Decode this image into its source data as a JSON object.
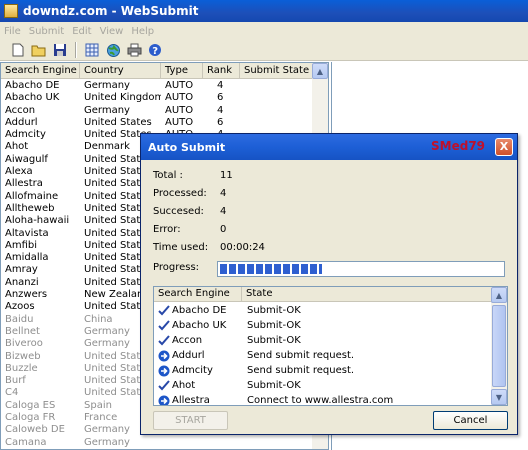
{
  "window": {
    "title": "downdz.com - WebSubmit"
  },
  "menu": [
    "File",
    "Submit",
    "Edit",
    "View",
    "Help"
  ],
  "toolbar": {
    "icons": [
      "new-icon",
      "open-icon",
      "save-icon",
      "grid-icon",
      "globe-icon",
      "print-icon",
      "help-icon"
    ]
  },
  "list": {
    "columns": [
      "Search Engine",
      "Country",
      "Type",
      "Rank",
      "Submit State"
    ],
    "rows": [
      {
        "engine": "Abacho DE",
        "country": "Germany",
        "type": "AUTO",
        "rank": "4",
        "state": "",
        "grey": false
      },
      {
        "engine": "Abacho UK",
        "country": "United Kingdom",
        "type": "AUTO",
        "rank": "6",
        "state": "",
        "grey": false
      },
      {
        "engine": "Accon",
        "country": "Germany",
        "type": "AUTO",
        "rank": "4",
        "state": "",
        "grey": false
      },
      {
        "engine": "Addurl",
        "country": "United States",
        "type": "AUTO",
        "rank": "6",
        "state": "",
        "grey": false
      },
      {
        "engine": "Admcity",
        "country": "United States",
        "type": "AUTO",
        "rank": "4",
        "state": "",
        "grey": false
      },
      {
        "engine": "Ahot",
        "country": "Denmark",
        "type": "",
        "rank": "",
        "state": "",
        "grey": false
      },
      {
        "engine": "Aiwagulf",
        "country": "United States",
        "type": "",
        "rank": "",
        "state": "",
        "grey": false
      },
      {
        "engine": "Alexa",
        "country": "United States",
        "type": "",
        "rank": "",
        "state": "",
        "grey": false
      },
      {
        "engine": "Allestra",
        "country": "United States",
        "type": "",
        "rank": "",
        "state": "",
        "grey": false
      },
      {
        "engine": "Allofmaine",
        "country": "United States",
        "type": "",
        "rank": "",
        "state": "",
        "grey": false
      },
      {
        "engine": "Alltheweb",
        "country": "United States",
        "type": "",
        "rank": "",
        "state": "",
        "grey": false
      },
      {
        "engine": "Aloha-hawaii",
        "country": "United States",
        "type": "",
        "rank": "",
        "state": "",
        "grey": false
      },
      {
        "engine": "Altavista",
        "country": "United States",
        "type": "",
        "rank": "",
        "state": "",
        "grey": false
      },
      {
        "engine": "Amfibi",
        "country": "United States",
        "type": "",
        "rank": "",
        "state": "",
        "grey": false
      },
      {
        "engine": "Amidalla",
        "country": "United States",
        "type": "",
        "rank": "",
        "state": "",
        "grey": false
      },
      {
        "engine": "Amray",
        "country": "United States",
        "type": "",
        "rank": "",
        "state": "",
        "grey": false
      },
      {
        "engine": "Ananzi",
        "country": "United States",
        "type": "",
        "rank": "",
        "state": "",
        "grey": false
      },
      {
        "engine": "Anzwers",
        "country": "New Zealand",
        "type": "",
        "rank": "",
        "state": "",
        "grey": false
      },
      {
        "engine": "Azoos",
        "country": "United States",
        "type": "",
        "rank": "",
        "state": "",
        "grey": false
      },
      {
        "engine": "Baidu",
        "country": "China",
        "type": "",
        "rank": "",
        "state": "",
        "grey": true
      },
      {
        "engine": "Bellnet",
        "country": "Germany",
        "type": "",
        "rank": "",
        "state": "",
        "grey": true
      },
      {
        "engine": "Biveroo",
        "country": "Germany",
        "type": "",
        "rank": "",
        "state": "",
        "grey": true
      },
      {
        "engine": "Bizweb",
        "country": "United States",
        "type": "",
        "rank": "",
        "state": "",
        "grey": true
      },
      {
        "engine": "Buzzle",
        "country": "United States",
        "type": "",
        "rank": "",
        "state": "",
        "grey": true
      },
      {
        "engine": "Burf",
        "country": "United States",
        "type": "",
        "rank": "",
        "state": "",
        "grey": true
      },
      {
        "engine": "C4",
        "country": "United States",
        "type": "",
        "rank": "",
        "state": "",
        "grey": true
      },
      {
        "engine": "Caloga ES",
        "country": "Spain",
        "type": "",
        "rank": "",
        "state": "",
        "grey": true
      },
      {
        "engine": "Caloga FR",
        "country": "France",
        "type": "",
        "rank": "",
        "state": "",
        "grey": true
      },
      {
        "engine": "Caloweb DE",
        "country": "Germany",
        "type": "",
        "rank": "",
        "state": "",
        "grey": true
      },
      {
        "engine": "Camana",
        "country": "Germany",
        "type": "",
        "rank": "",
        "state": "",
        "grey": true
      }
    ]
  },
  "dialog": {
    "title": "Auto Submit",
    "watermark": "SMed79",
    "close": "X",
    "stats": [
      {
        "label": "Total :",
        "value": "11"
      },
      {
        "label": "Processed:",
        "value": "4"
      },
      {
        "label": "Succesed:",
        "value": "4"
      },
      {
        "label": "Error:",
        "value": "0"
      },
      {
        "label": "Time used:",
        "value": "00:00:24"
      }
    ],
    "progress_label": "Progress:",
    "progress_fraction": 0.36,
    "columns": [
      "Search Engine",
      "State"
    ],
    "rows": [
      {
        "icon": "check-icon",
        "engine": "Abacho DE",
        "state": "Submit-OK"
      },
      {
        "icon": "check-icon",
        "engine": "Abacho UK",
        "state": "Submit-OK"
      },
      {
        "icon": "check-icon",
        "engine": "Accon",
        "state": "Submit-OK"
      },
      {
        "icon": "arrow-icon",
        "engine": "Addurl",
        "state": "Send submit request."
      },
      {
        "icon": "arrow-icon",
        "engine": "Admcity",
        "state": "Send submit request."
      },
      {
        "icon": "check-icon",
        "engine": "Ahot",
        "state": "Submit-OK"
      },
      {
        "icon": "arrow-icon",
        "engine": "Allestra",
        "state": "Connect to www.allestra.com"
      }
    ],
    "start_label": "START",
    "cancel_label": "Cancel"
  }
}
